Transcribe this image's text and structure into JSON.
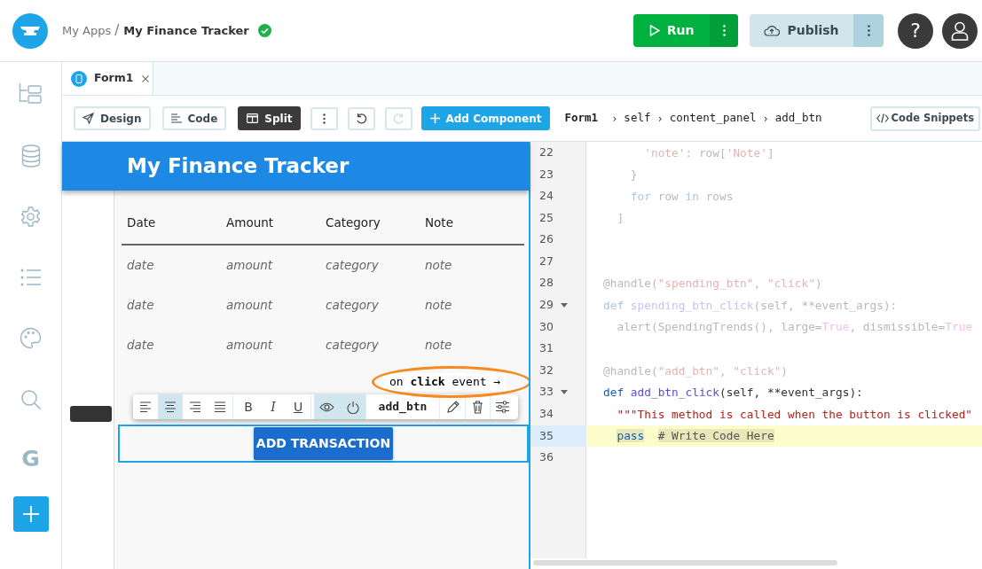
{
  "header": {
    "breadcrumb_parent": "My Apps",
    "separator": "/",
    "app_name": "My Finance Tracker",
    "saved": true,
    "run_label": "Run",
    "publish_label": "Publish",
    "help_label": "?"
  },
  "sidebar": {
    "glyph": "G"
  },
  "tabs": [
    {
      "label": "Form1",
      "selected": true
    }
  ],
  "toolbar": {
    "view_modes": [
      {
        "label": "Design",
        "kind": "design",
        "selected": false
      },
      {
        "label": "Code",
        "kind": "code",
        "selected": false
      },
      {
        "label": "Split",
        "kind": "split",
        "selected": true
      }
    ],
    "undo_disabled": false,
    "redo_disabled": true,
    "add_component": "Add Component",
    "path": [
      "Form1",
      "self",
      "content_panel",
      "add_btn"
    ],
    "path_separator": "›",
    "snippets": "Code Snippets"
  },
  "form": {
    "title": "My Finance Tracker",
    "columns": [
      "Date",
      "Amount",
      "Category",
      "Note"
    ],
    "rows": [
      [
        "date",
        "amount",
        "category",
        "note"
      ],
      [
        "date",
        "amount",
        "category",
        "note"
      ],
      [
        "date",
        "amount",
        "category",
        "note"
      ]
    ],
    "event_hint": "on **click** event →",
    "component_toolbar": {
      "align": [
        {
          "kind": "left",
          "selected": false
        },
        {
          "kind": "center",
          "selected": true
        },
        {
          "kind": "right",
          "selected": false
        },
        {
          "kind": "justify",
          "selected": false
        }
      ],
      "format": [
        "B",
        "I",
        "U"
      ],
      "visible": true,
      "enabled": true,
      "name": "add_btn"
    },
    "button_label": "ADD TRANSACTION"
  },
  "code": {
    "lines": [
      {
        "number": "22",
        "faded": true,
        "tokens": [
          {
            "kind": "string",
            "text": "      'note'"
          },
          {
            "kind": "plain",
            "text": ": row["
          },
          {
            "kind": "string",
            "text": "'Note'"
          },
          {
            "kind": "plain",
            "text": "]"
          }
        ]
      },
      {
        "number": "23",
        "faded": true,
        "tokens": [
          {
            "kind": "plain",
            "text": "    }"
          }
        ]
      },
      {
        "number": "24",
        "faded": true,
        "tokens": [
          {
            "kind": "keyword",
            "text": "    for"
          },
          {
            "kind": "plain",
            "text": " row "
          },
          {
            "kind": "keyword",
            "text": "in"
          },
          {
            "kind": "plain",
            "text": " rows"
          }
        ]
      },
      {
        "number": "25",
        "faded": true,
        "tokens": [
          {
            "kind": "plain",
            "text": "  ]"
          }
        ]
      },
      {
        "number": "26"
      },
      {
        "number": "27"
      },
      {
        "number": "28",
        "faded": true,
        "tokens": [
          {
            "kind": "plain",
            "text": "@handle("
          },
          {
            "kind": "string",
            "text": "\"spending_btn\""
          },
          {
            "kind": "plain",
            "text": ", "
          },
          {
            "kind": "string",
            "text": "\"click\""
          },
          {
            "kind": "plain",
            "text": ")"
          }
        ]
      },
      {
        "number": "29",
        "faded": true,
        "foldable": true,
        "tokens": [
          {
            "kind": "keyword",
            "text": "def"
          },
          {
            "kind": "function",
            "text": " spending_btn_click"
          },
          {
            "kind": "plain",
            "text": "(self, **event_args):"
          }
        ]
      },
      {
        "number": "30",
        "faded": true,
        "tokens": [
          {
            "kind": "plain",
            "text": "  alert(SpendingTrends(), large="
          },
          {
            "kind": "constant",
            "text": "True"
          },
          {
            "kind": "plain",
            "text": ", dismissible="
          },
          {
            "kind": "constant",
            "text": "True"
          }
        ]
      },
      {
        "number": "31"
      },
      {
        "number": "32",
        "faded": true,
        "tokens": [
          {
            "kind": "plain",
            "text": "@handle("
          },
          {
            "kind": "string",
            "text": "\"add_btn\""
          },
          {
            "kind": "plain",
            "text": ", "
          },
          {
            "kind": "string",
            "text": "\"click\""
          },
          {
            "kind": "plain",
            "text": ")"
          }
        ]
      },
      {
        "number": "33",
        "faded": false,
        "foldable": true,
        "tokens": [
          {
            "kind": "keyword",
            "text": "def"
          },
          {
            "kind": "function",
            "text": " add_btn_click"
          },
          {
            "kind": "plain",
            "text": "(self, **event_args):"
          }
        ]
      },
      {
        "number": "34",
        "faded": false,
        "tokens": [
          {
            "kind": "string",
            "text": "  \"\"\"This method is called when the button is clicked\""
          }
        ]
      },
      {
        "number": "35",
        "faded": false,
        "highlighted": true,
        "tokens": [
          {
            "kind": "keyword",
            "text": "  pass"
          },
          {
            "kind": "comment",
            "text": "  # Write Code Here"
          }
        ]
      },
      {
        "number": "36"
      }
    ]
  }
}
